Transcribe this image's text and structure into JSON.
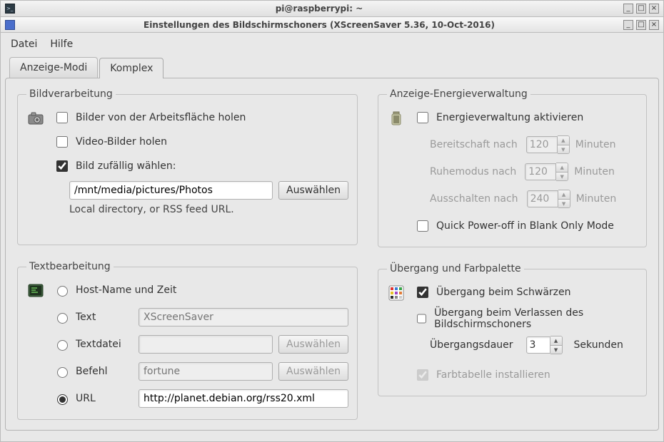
{
  "outer_window": {
    "title": "pi@raspberrypi: ~"
  },
  "dialog": {
    "title": "Einstellungen des Bildschirmschoners  (XScreenSaver 5.36, 10-Oct-2016)"
  },
  "menu": {
    "file": "Datei",
    "help": "Hilfe"
  },
  "tabs": {
    "display": "Anzeige-Modi",
    "advanced": "Komplex"
  },
  "image": {
    "legend": "Bildverarbeitung",
    "grab_desktop": "Bilder von der Arbeitsfläche holen",
    "grab_video": "Video-Bilder holen",
    "choose_random": "Bild zufällig wählen:",
    "path_value": "/mnt/media/pictures/Photos",
    "browse": "Auswählen",
    "hint": "Local directory, or RSS feed URL."
  },
  "text": {
    "legend": "Textbearbeitung",
    "host_time": "Host-Name und Zeit",
    "text": "Text",
    "text_placeholder": "XScreenSaver",
    "textfile": "Textdatei",
    "command": "Befehl",
    "command_placeholder": "fortune",
    "url": "URL",
    "url_value": "http://planet.debian.org/rss20.xml",
    "browse": "Auswählen"
  },
  "power": {
    "legend": "Anzeige-Energieverwaltung",
    "enable": "Energieverwaltung aktivieren",
    "standby_label": "Bereitschaft nach",
    "suspend_label": "Ruhemodus nach",
    "off_label": "Ausschalten nach",
    "standby_val": "120",
    "suspend_val": "120",
    "off_val": "240",
    "minutes": "Minuten",
    "quick_poweroff": "Quick Power-off in Blank Only Mode"
  },
  "fade": {
    "legend": "Übergang und Farbpalette",
    "fade_black": "Übergang beim Schwärzen",
    "fade_unblank": "Übergang beim Verlassen des Bildschirmschoners",
    "duration_label": "Übergangsdauer",
    "duration_val": "3",
    "seconds": "Sekunden",
    "install_cmap": "Farbtabelle installieren"
  }
}
